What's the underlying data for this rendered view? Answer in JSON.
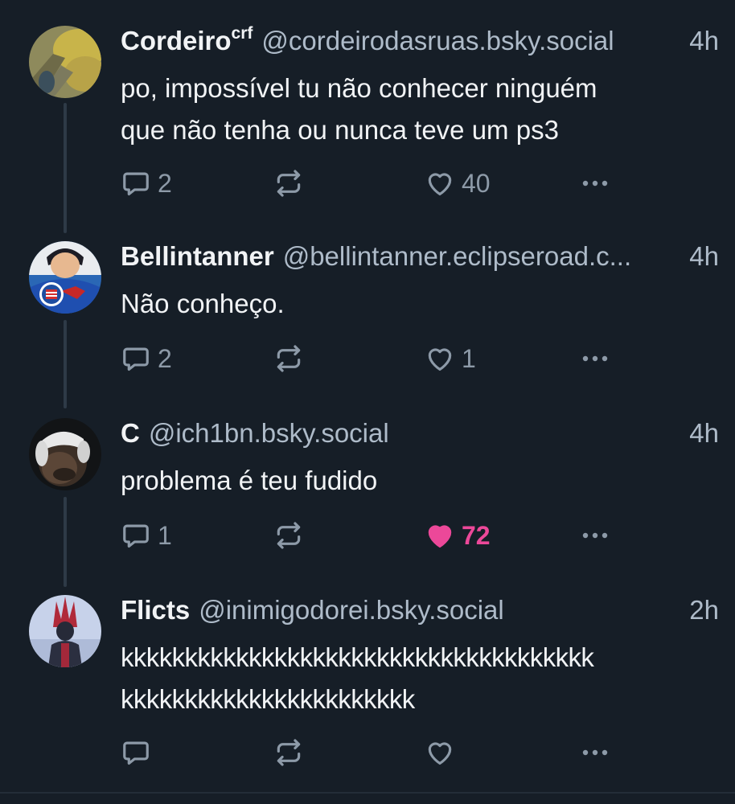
{
  "posts": [
    {
      "name": "Cordeiro",
      "name_suffix": "crf",
      "handle": "@cordeirodasruas.bsky.social",
      "time": "4h",
      "text": "po, impossível tu não conhecer ninguém\nque não tenha ou nunca teve um ps3",
      "reply_count": "2",
      "repost_count": "",
      "like_count": "40",
      "liked": false
    },
    {
      "name": "Bellintanner",
      "name_suffix": "",
      "handle": "@bellintanner.eclipseroad.c...",
      "time": "4h",
      "text": "Não conheço.",
      "reply_count": "2",
      "repost_count": "",
      "like_count": "1",
      "liked": false
    },
    {
      "name": "C",
      "name_suffix": "",
      "handle": "@ich1bn.bsky.social",
      "time": "4h",
      "text": "problema é teu fudido",
      "reply_count": "1",
      "repost_count": "",
      "like_count": "72",
      "liked": true
    },
    {
      "name": "Flicts",
      "name_suffix": "",
      "handle": "@inimigodorei.bsky.social",
      "time": "2h",
      "text": "kkkkkkkkkkkkkkkkkkkkkkkkkkkkkkkkkkkkk\nkkkkkkkkkkkkkkkkkkkkkkk",
      "reply_count": "",
      "repost_count": "",
      "like_count": "",
      "liked": false
    }
  ],
  "colors": {
    "background": "#161e27",
    "text_primary": "#f1f3f5",
    "text_secondary": "#aebbc9",
    "icon": "#8d9aa8",
    "like_active": "#ec4899",
    "thread_line": "#2e3a47"
  },
  "icons": {
    "reply": "reply-icon",
    "repost": "repost-icon",
    "like": "heart-icon",
    "more": "more-options-icon"
  }
}
